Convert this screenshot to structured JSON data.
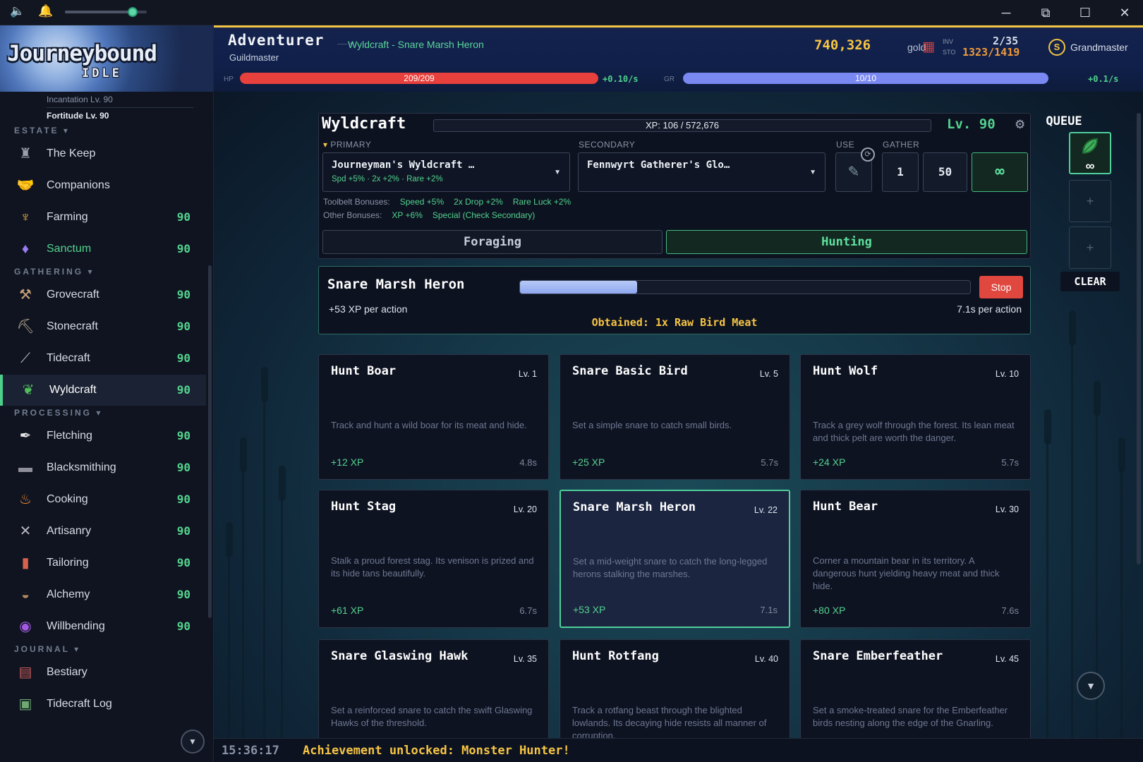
{
  "window": {
    "volume_level": 0.83,
    "controls": {
      "minimize": "─",
      "pip": "⧉",
      "maximize": "☐",
      "close": "✕"
    }
  },
  "sidebar": {
    "logo_title": "Journeybound",
    "logo_subtitle": "IDLE",
    "partial_rows": [
      "Incantation Lv. 90",
      "Fortitude Lv. 90"
    ],
    "sections": [
      {
        "title": "ESTATE ▾",
        "items": [
          {
            "label": "The Keep",
            "level": "",
            "icon": "keep-tower-icon"
          },
          {
            "label": "Companions",
            "level": "",
            "icon": "handshake-icon"
          },
          {
            "label": "Farming",
            "level": "90",
            "icon": "wheat-icon"
          },
          {
            "label": "Sanctum",
            "level": "90",
            "icon": "crystal-icon"
          }
        ]
      },
      {
        "title": "GATHERING ▾",
        "items": [
          {
            "label": "Grovecraft",
            "level": "90",
            "icon": "axe-icon"
          },
          {
            "label": "Stonecraft",
            "level": "90",
            "icon": "pickaxe-icon"
          },
          {
            "label": "Tidecraft",
            "level": "90",
            "icon": "fishing-rod-icon"
          },
          {
            "label": "Wyldcraft",
            "level": "90",
            "icon": "leaf-icon",
            "active": true
          }
        ]
      },
      {
        "title": "PROCESSING ▾",
        "items": [
          {
            "label": "Fletching",
            "level": "90",
            "icon": "feather-quill-icon"
          },
          {
            "label": "Blacksmithing",
            "level": "90",
            "icon": "anvil-icon"
          },
          {
            "label": "Cooking",
            "level": "90",
            "icon": "cooking-pot-icon"
          },
          {
            "label": "Artisanry",
            "level": "90",
            "icon": "crossed-tools-icon"
          },
          {
            "label": "Tailoring",
            "level": "90",
            "icon": "thread-spool-icon"
          },
          {
            "label": "Alchemy",
            "level": "90",
            "icon": "mortar-pestle-icon"
          },
          {
            "label": "Willbending",
            "level": "90",
            "icon": "vortex-icon"
          }
        ]
      },
      {
        "title": "JOURNAL ▾",
        "items": [
          {
            "label": "Bestiary",
            "level": "",
            "icon": "bestiary-book-icon"
          },
          {
            "label": "Tidecraft Log",
            "level": "",
            "icon": "log-book-icon"
          }
        ]
      }
    ]
  },
  "header": {
    "title": "Adventurer",
    "rank": "Guildmaster",
    "activity": "Wyldcraft - Snare Marsh Heron",
    "gold": "740,326",
    "gold_label": "gold",
    "inv_label": "INV",
    "sto_label": "STO",
    "inv_value": "2/35",
    "sto_value": "1323/1419",
    "badge_letter": "S",
    "badge_label": "Grandmaster",
    "hp": {
      "tag": "HP",
      "text": "209/209",
      "fraction": 1.0,
      "rate": "+0.10/s",
      "color": "#e8403d"
    },
    "gr": {
      "tag": "GR",
      "text": "10/10",
      "fraction": 1.0,
      "rate": "+0.1/s",
      "color": "#7a89f2"
    }
  },
  "skill": {
    "name": "Wyldcraft",
    "xp_text": "XP: 106 / 572,676",
    "xp_fraction": 0.0002,
    "level": "Lv. 90",
    "primary_label": "PRIMARY",
    "secondary_label": "SECONDARY",
    "use_label": "USE",
    "gather_label": "GATHER",
    "primary_tool": {
      "name": "Journeyman's Wyldcraft …",
      "stats": "Spd +5% · 2x +2% · Rare +2%"
    },
    "secondary_tool": {
      "name": "Fennwyrt Gatherer's Glo…"
    },
    "gather_options": [
      "1",
      "50",
      "∞"
    ],
    "toolbelt_label": "Toolbelt Bonuses:",
    "toolbelt_bonuses": [
      "Speed +5%",
      "2x Drop +2%",
      "Rare Luck +2%"
    ],
    "other_label": "Other Bonuses:",
    "other_bonuses": [
      "XP +6%",
      "Special (Check Secondary)"
    ],
    "tabs": [
      {
        "label": "Foraging",
        "active": false
      },
      {
        "label": "Hunting",
        "active": true
      }
    ]
  },
  "active_action": {
    "name": "Snare Marsh Heron",
    "progress": 0.26,
    "stop_label": "Stop",
    "xp": "+53 XP per action",
    "time": "7.1s per action",
    "obtained": "Obtained: 1x Raw Bird Meat"
  },
  "actions": [
    {
      "title": "Hunt Boar",
      "level": "Lv. 1",
      "desc": "Track and hunt a wild boar for its meat and hide.",
      "xp": "+12 XP",
      "time": "4.8s"
    },
    {
      "title": "Snare Basic Bird",
      "level": "Lv. 5",
      "desc": "Set a simple snare to catch small birds.",
      "xp": "+25 XP",
      "time": "5.7s"
    },
    {
      "title": "Hunt Wolf",
      "level": "Lv. 10",
      "desc": "Track a grey wolf through the forest. Its lean meat and thick pelt are worth the danger.",
      "xp": "+24 XP",
      "time": "5.7s"
    },
    {
      "title": "Hunt Stag",
      "level": "Lv. 20",
      "desc": "Stalk a proud forest stag. Its venison is prized and its hide tans beautifully.",
      "xp": "+61 XP",
      "time": "6.7s"
    },
    {
      "title": "Snare Marsh Heron",
      "level": "Lv. 22",
      "desc": "Set a mid-weight snare to catch the long-legged herons stalking the marshes.",
      "xp": "+53 XP",
      "time": "7.1s",
      "selected": true
    },
    {
      "title": "Hunt Bear",
      "level": "Lv. 30",
      "desc": "Corner a mountain bear in its territory. A dangerous hunt yielding heavy meat and thick hide.",
      "xp": "+80 XP",
      "time": "7.6s"
    },
    {
      "title": "Snare Glaswing Hawk",
      "level": "Lv. 35",
      "desc": "Set a reinforced snare to catch the swift Glaswing Hawks of the threshold.",
      "xp": "",
      "time": ""
    },
    {
      "title": "Hunt Rotfang",
      "level": "Lv. 40",
      "desc": "Track a rotfang beast through the blighted lowlands. Its decaying hide resists all manner of corruption.",
      "xp": "",
      "time": ""
    },
    {
      "title": "Snare Emberfeather",
      "level": "Lv. 45",
      "desc": "Set a smoke-treated snare for the Emberfeather birds nesting along the edge of the Gnarling.",
      "xp": "",
      "time": ""
    }
  ],
  "queue": {
    "title": "QUEUE",
    "slot_count": "∞",
    "add_symbol": "+",
    "clear_label": "CLEAR"
  },
  "log": {
    "time": "15:36:17",
    "message": "Achievement unlocked: Monster Hunter!"
  }
}
